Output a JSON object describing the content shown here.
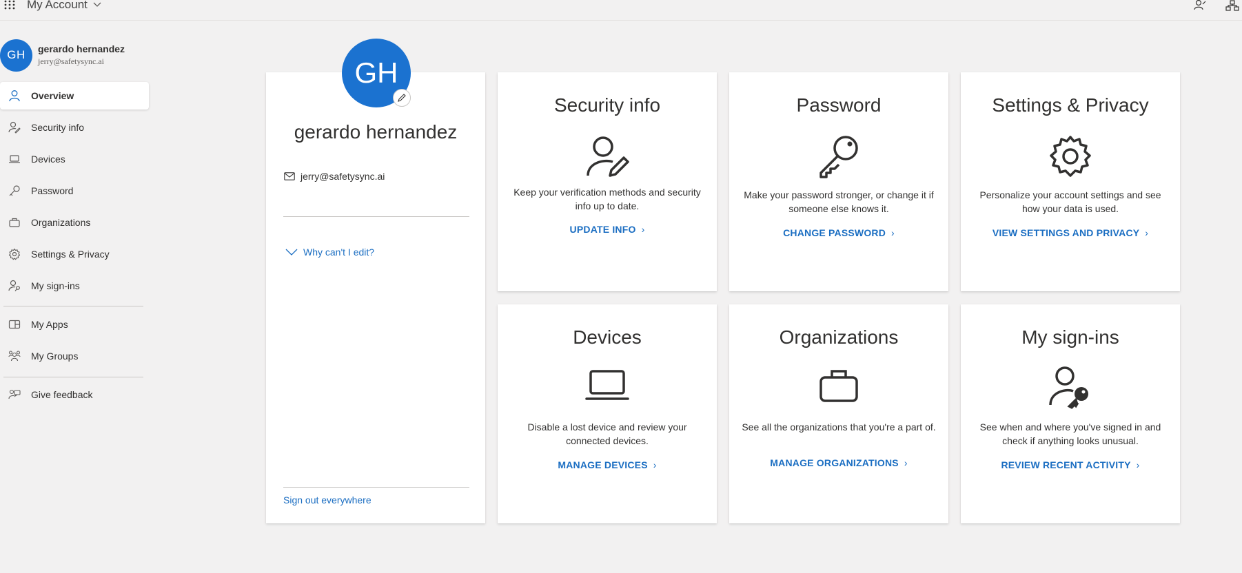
{
  "header": {
    "title": "My Account"
  },
  "user": {
    "initials": "GH",
    "name": "gerardo hernandez",
    "email": "jerry@safetysync.ai"
  },
  "sidebar": {
    "items": [
      {
        "label": "Overview",
        "icon": "person-icon",
        "active": true
      },
      {
        "label": "Security info",
        "icon": "person-edit-icon"
      },
      {
        "label": "Devices",
        "icon": "laptop-icon"
      },
      {
        "label": "Password",
        "icon": "key-icon"
      },
      {
        "label": "Organizations",
        "icon": "briefcase-icon"
      },
      {
        "label": "Settings & Privacy",
        "icon": "gear-icon"
      },
      {
        "label": "My sign-ins",
        "icon": "person-key-icon"
      },
      {
        "label": "My Apps",
        "icon": "apps-icon"
      },
      {
        "label": "My Groups",
        "icon": "people-icon"
      },
      {
        "label": "Give feedback",
        "icon": "feedback-icon"
      }
    ]
  },
  "profile": {
    "why_cant_edit": "Why can't I edit?",
    "sign_out_everywhere": "Sign out everywhere"
  },
  "tiles": [
    {
      "title": "Security info",
      "icon": "person-edit-icon",
      "desc": "Keep your verification methods and security info up to date.",
      "link": "UPDATE INFO"
    },
    {
      "title": "Password",
      "icon": "key-icon",
      "desc": "Make your password stronger, or change it if someone else knows it.",
      "link": "CHANGE PASSWORD"
    },
    {
      "title": "Settings & Privacy",
      "icon": "gear-icon",
      "desc": "Personalize your account settings and see how your data is used.",
      "link": "VIEW SETTINGS AND PRIVACY"
    },
    {
      "title": "Devices",
      "icon": "laptop-icon",
      "desc": "Disable a lost device and review your connected devices.",
      "link": "MANAGE DEVICES"
    },
    {
      "title": "Organizations",
      "icon": "briefcase-icon",
      "desc": "See all the organizations that you're a part of.",
      "link": "MANAGE ORGANIZATIONS"
    },
    {
      "title": "My sign-ins",
      "icon": "person-key-icon",
      "desc": "See when and where you've signed in and check if anything looks unusual.",
      "link": "REVIEW RECENT ACTIVITY"
    }
  ],
  "colors": {
    "accent": "#1b72d0",
    "link": "#1b6ec2",
    "background": "#f2f1f1"
  }
}
